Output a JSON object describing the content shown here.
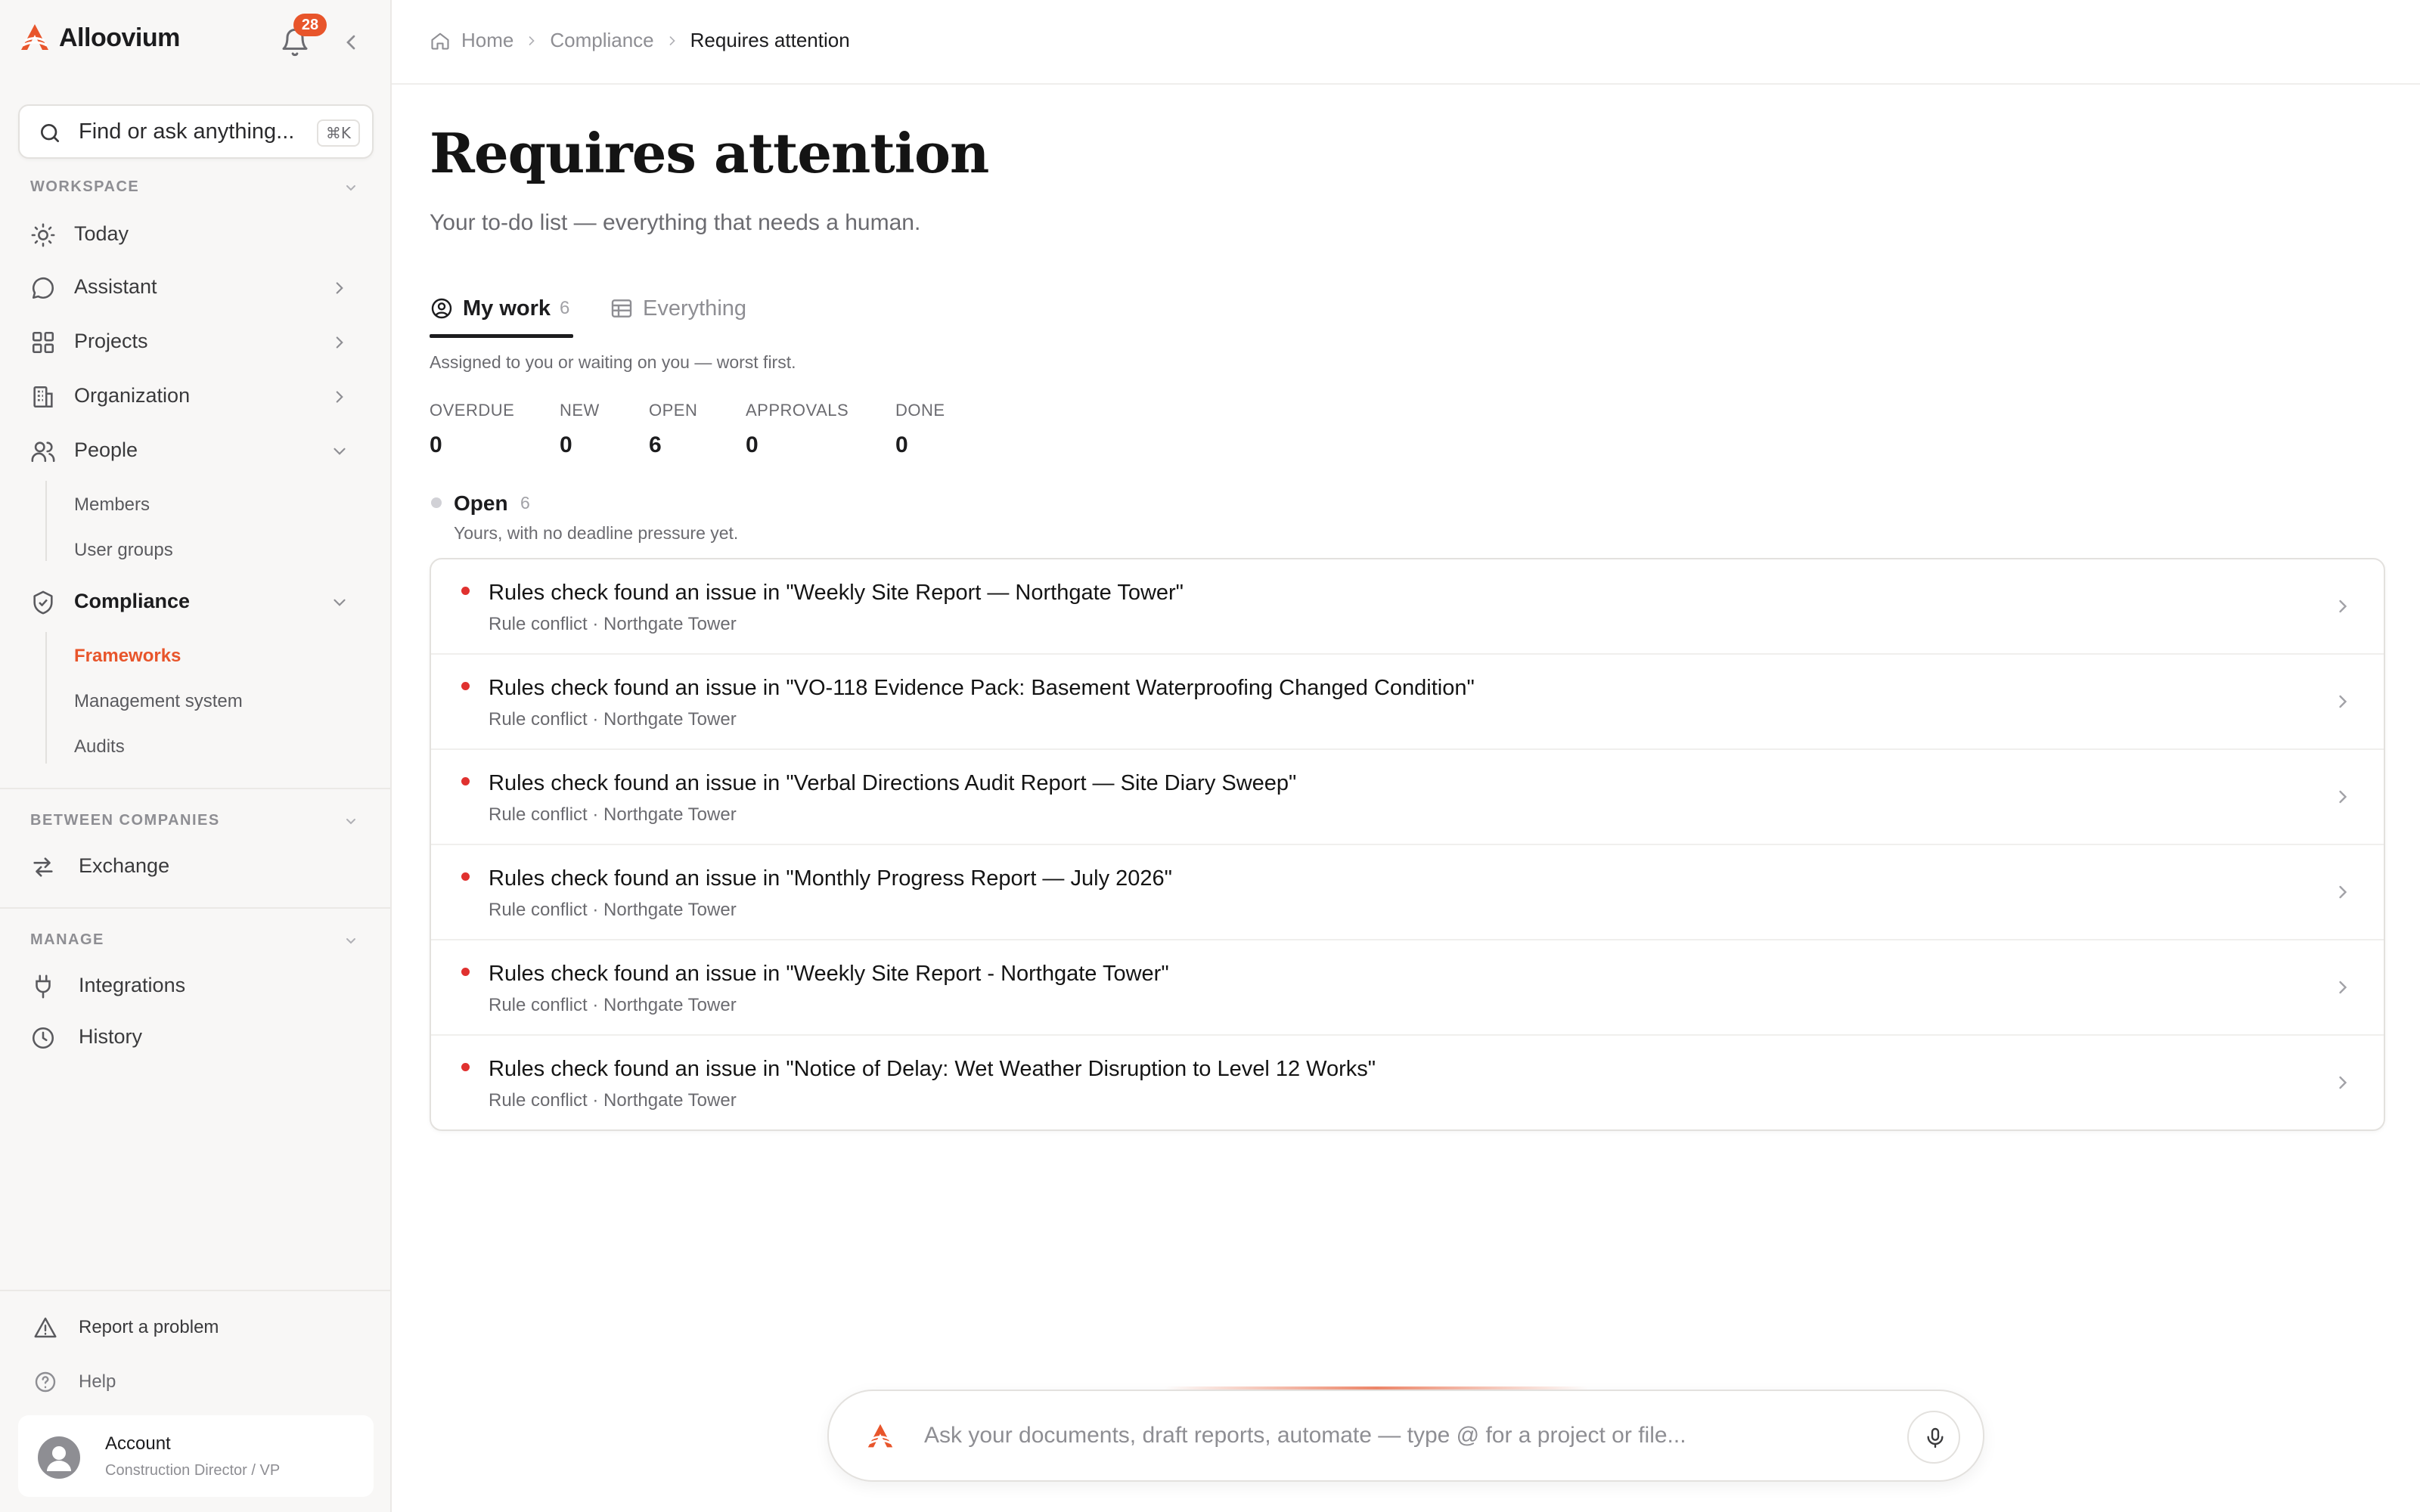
{
  "brand": {
    "name": "Alloovium",
    "accent": "#e8552b"
  },
  "notifications": {
    "count": "28"
  },
  "search": {
    "placeholder": "Find or ask anything...",
    "shortcut": "⌘K"
  },
  "sidebar": {
    "workspace_label": "WORKSPACE",
    "workspace_items": [
      {
        "label": "Today",
        "icon": "sun-icon"
      },
      {
        "label": "Assistant",
        "icon": "chat-bubble-icon"
      },
      {
        "label": "Projects",
        "icon": "grid-icon"
      },
      {
        "label": "Organization",
        "icon": "building-icon"
      },
      {
        "label": "People",
        "icon": "users-icon"
      }
    ],
    "people_sub": [
      "Members",
      "User groups"
    ],
    "compliance": {
      "label": "Compliance",
      "icon": "shield-check-icon"
    },
    "compliance_sub": [
      "Frameworks",
      "Management system",
      "Audits"
    ],
    "between_label": "BETWEEN COMPANIES",
    "between_items": [
      {
        "label": "Exchange",
        "icon": "arrows-exchange-icon"
      }
    ],
    "manage_label": "MANAGE",
    "manage_items": [
      {
        "label": "Integrations",
        "icon": "plug-icon"
      },
      {
        "label": "History",
        "icon": "clock-icon"
      }
    ],
    "footer": [
      {
        "label": "Report a problem",
        "icon": "warning-triangle-icon"
      },
      {
        "label": "Help",
        "icon": "help-circle-icon"
      }
    ],
    "account": {
      "name": "Account",
      "role": "Construction Director / VP"
    }
  },
  "breadcrumb": [
    "Home",
    "Compliance",
    "Requires attention"
  ],
  "page": {
    "title": "Requires attention",
    "subtitle": "Your to-do list — everything that needs a human."
  },
  "tabs": [
    {
      "label": "My work",
      "count": "6",
      "icon": "user-circle-icon",
      "active": true
    },
    {
      "label": "Everything",
      "icon": "table-icon",
      "active": false
    }
  ],
  "tab_hint": "Assigned to you or waiting on you — worst first.",
  "stats": [
    {
      "label": "OVERDUE",
      "value": "0"
    },
    {
      "label": "NEW",
      "value": "0"
    },
    {
      "label": "OPEN",
      "value": "6"
    },
    {
      "label": "APPROVALS",
      "value": "0"
    },
    {
      "label": "DONE",
      "value": "0"
    }
  ],
  "group": {
    "title": "Open",
    "count": "6",
    "description": "Yours, with no deadline pressure yet."
  },
  "items": [
    {
      "title": "Rules check found an issue in \"Weekly Site Report — Northgate Tower\"",
      "meta": "Rule conflict · Northgate Tower"
    },
    {
      "title": "Rules check found an issue in \"VO-118 Evidence Pack: Basement Waterproofing Changed Condition\"",
      "meta": "Rule conflict · Northgate Tower"
    },
    {
      "title": "Rules check found an issue in \"Verbal Directions Audit Report — Site Diary Sweep\"",
      "meta": "Rule conflict · Northgate Tower"
    },
    {
      "title": "Rules check found an issue in \"Monthly Progress Report — July 2026\"",
      "meta": "Rule conflict · Northgate Tower"
    },
    {
      "title": "Rules check found an issue in \"Weekly Site Report - Northgate Tower\"",
      "meta": "Rule conflict · Northgate Tower"
    },
    {
      "title": "Rules check found an issue in \"Notice of Delay: Wet Weather Disruption to Level 12 Works\"",
      "meta": "Rule conflict · Northgate Tower"
    }
  ],
  "composer": {
    "placeholder": "Ask your documents, draft reports, automate — type @ for a project or file..."
  }
}
